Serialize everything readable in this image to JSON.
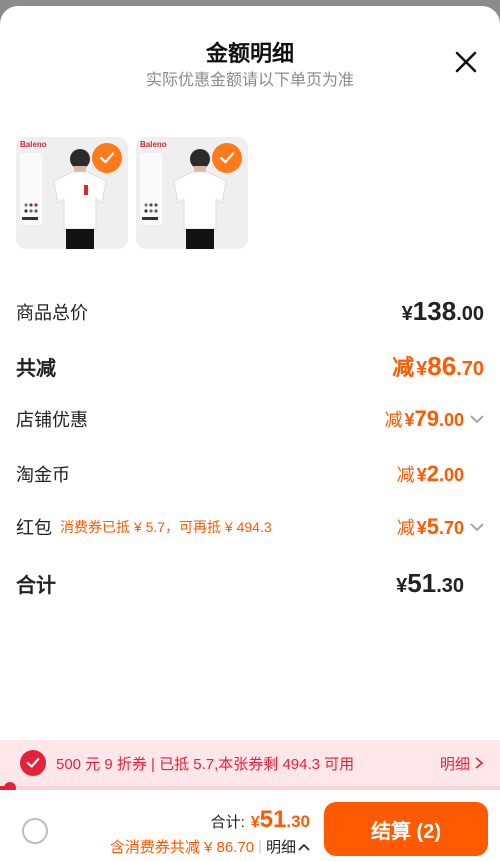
{
  "header": {
    "title": "金额明细",
    "subtitle": "实际优惠金额请以下单页为准"
  },
  "products": [
    {
      "brand": "Baleno"
    },
    {
      "brand": "Baleno"
    }
  ],
  "summary": {
    "goods_total": {
      "label": "商品总价",
      "yen": "¥",
      "int": "138",
      "dec": ".00"
    },
    "total_reduce": {
      "label": "共减",
      "pre": "减",
      "yen": "¥",
      "int": "86",
      "dec": ".70"
    },
    "store_discount": {
      "label": "店铺优惠",
      "pre": "减",
      "yen": "¥",
      "int": "79",
      "dec": ".00"
    },
    "gold_coin": {
      "label": "淘金币",
      "pre": "减",
      "yen": "¥",
      "int": "2",
      "dec": ".00"
    },
    "red_packet": {
      "label": "红包",
      "note": "消费券已抵 ¥ 5.7，可再抵 ¥ 494.3",
      "pre": "减",
      "yen": "¥",
      "int": "5",
      "dec": ".70"
    },
    "total": {
      "label": "合计",
      "yen": "¥",
      "int": "51",
      "dec": ".30"
    }
  },
  "coupon_bar": {
    "text": "500 元 9 折券 | 已抵 5.7,本张券剩 494.3 可用",
    "detail_label": "明细",
    "progress": 0.02
  },
  "footer": {
    "total_label": "合计:",
    "yen": "¥",
    "int": "51",
    "dec": ".30",
    "sub_text": "含消费券共减 ¥ 86.70",
    "detail_label": "明细",
    "checkout_label": "结算 (2)"
  },
  "colors": {
    "accent": "#ff5a00",
    "coupon_red": "#e8213b",
    "check_orange": "#ff7a1a"
  }
}
